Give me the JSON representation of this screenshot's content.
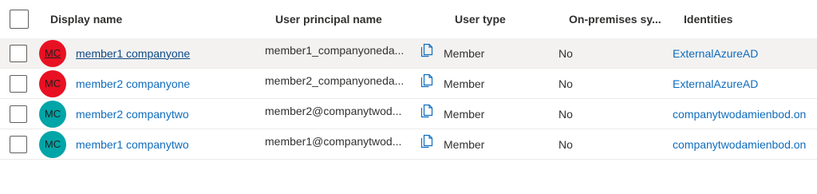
{
  "header": {
    "display_name": "Display name",
    "upn": "User principal name",
    "user_type": "User type",
    "onprem": "On-premises sy...",
    "identities": "Identities"
  },
  "rows": [
    {
      "initials": "MC",
      "avatar_color": "#e81123",
      "display_name": "member1 companyone",
      "upn": "member1_companyoneda...",
      "user_type": "Member",
      "onprem": "No",
      "identities": "ExternalAzureAD"
    },
    {
      "initials": "MC",
      "avatar_color": "#e81123",
      "display_name": "member2 companyone",
      "upn": "member2_companyoneda...",
      "user_type": "Member",
      "onprem": "No",
      "identities": "ExternalAzureAD"
    },
    {
      "initials": "MC",
      "avatar_color": "#00a5a8",
      "display_name": "member2 companytwo",
      "upn": "member2@companytwod...",
      "user_type": "Member",
      "onprem": "No",
      "identities": "companytwodamienbod.on"
    },
    {
      "initials": "MC",
      "avatar_color": "#00a5a8",
      "display_name": "member1 companytwo",
      "upn": "member1@companytwod...",
      "user_type": "Member",
      "onprem": "No",
      "identities": "companytwodamienbod.on"
    }
  ],
  "icons": {
    "copy": "copy-icon"
  },
  "colors": {
    "link": "#0f6cbd",
    "hover_row": "#f3f2f1",
    "red_avatar": "#e81123",
    "teal_avatar": "#00a5a8"
  }
}
